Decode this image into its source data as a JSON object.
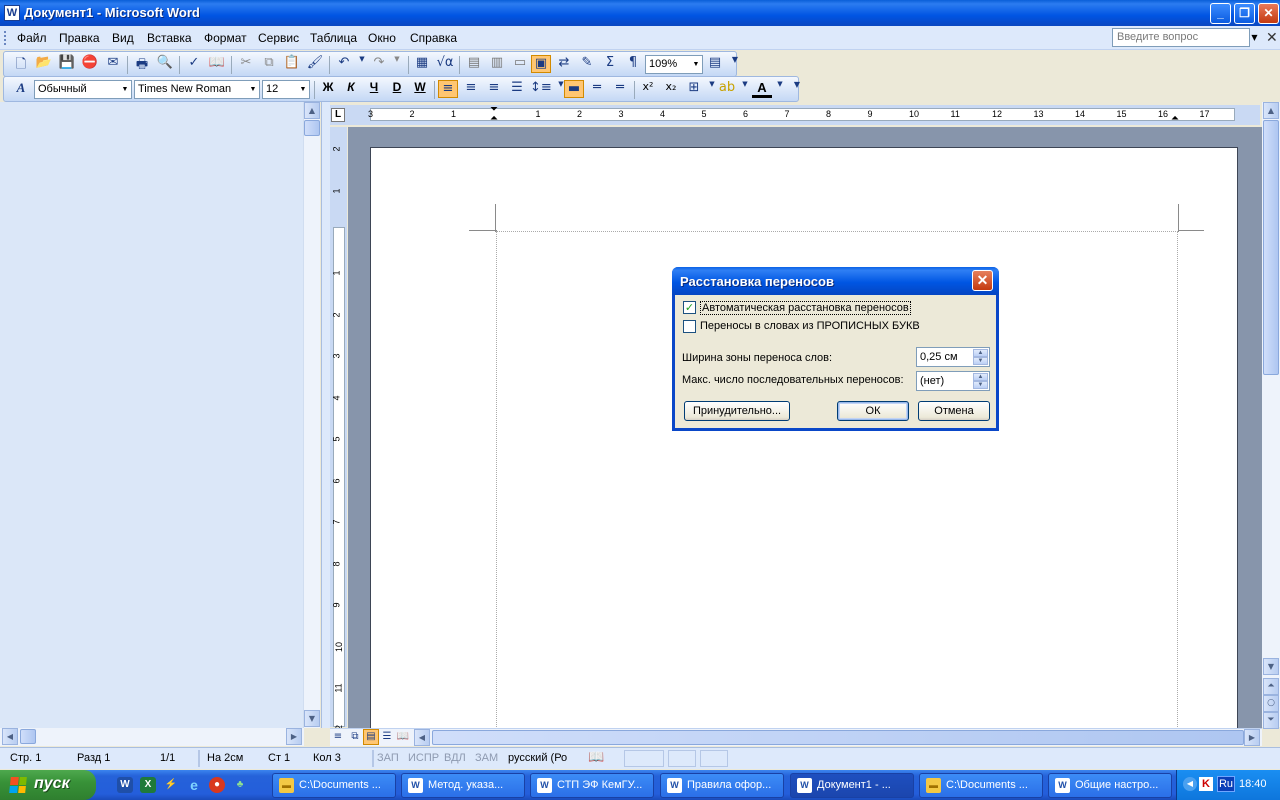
{
  "window": {
    "title": "Документ1 - Microsoft Word",
    "app_icon": "word-icon",
    "controls": [
      "minimize",
      "restore",
      "close"
    ]
  },
  "menubar": {
    "items": [
      "Файл",
      "Правка",
      "Вид",
      "Вставка",
      "Формат",
      "Сервис",
      "Таблица",
      "Окно",
      "Справка"
    ],
    "help_placeholder": "Введите вопрос"
  },
  "toolbar_standard": {
    "zoom": "109%"
  },
  "toolbar_formatting": {
    "style": "Обычный",
    "font": "Times New Roman",
    "size": "12",
    "bold": "Ж",
    "italic": "К",
    "underline": "Ч",
    "strike": "D",
    "wordart": "W"
  },
  "ruler": {
    "horizontal_numbers": [
      "3",
      "2",
      "1",
      "1",
      "2",
      "3",
      "4",
      "5",
      "6",
      "7",
      "8",
      "9",
      "10",
      "11",
      "12",
      "13",
      "14",
      "15",
      "16",
      "17"
    ],
    "vertical_numbers": [
      "2",
      "1",
      "1",
      "2",
      "3",
      "4",
      "5",
      "6",
      "7",
      "8",
      "9",
      "10",
      "11",
      "12"
    ],
    "tab_selector": "L"
  },
  "dialog": {
    "title": "Расстановка переносов",
    "auto_hyphenation_label": "Автоматическая расстановка переносов",
    "auto_hyphenation_checked": true,
    "caps_hyphenation_label": "Переносы в словах из ПРОПИСНЫХ БУКВ",
    "caps_hyphenation_checked": false,
    "zone_width_label": "Ширина зоны переноса слов:",
    "zone_width_value": "0,25 см",
    "max_consecutive_label": "Макс. число последовательных переносов:",
    "max_consecutive_value": "(нет)",
    "manual_button": "Принудительно...",
    "ok_button": "ОК",
    "cancel_button": "Отмена"
  },
  "statusbar": {
    "page": "Стр. 1",
    "section": "Разд 1",
    "pages": "1/1",
    "at": "На 2см",
    "line": "Ст 1",
    "col": "Кол 3",
    "rec": "ЗАП",
    "trk": "ИСПР",
    "ext": "ВДЛ",
    "ovr": "ЗАМ",
    "language": "русский (Ро"
  },
  "taskbar": {
    "start_label": "пуск",
    "tasks": [
      {
        "label": "C:\\Documents ...",
        "icon": "folder-icon",
        "active": false
      },
      {
        "label": "Метод. указа...",
        "icon": "word-icon",
        "active": false
      },
      {
        "label": "СТП ЭФ КемГУ...",
        "icon": "word-icon",
        "active": false
      },
      {
        "label": "Правила офор...",
        "icon": "word-icon",
        "active": false
      },
      {
        "label": "Документ1 - ...",
        "icon": "word-icon",
        "active": true
      },
      {
        "label": "C:\\Documents ...",
        "icon": "folder-icon",
        "active": false
      },
      {
        "label": "Общие настро...",
        "icon": "word-icon",
        "active": false
      }
    ],
    "language": "Ru",
    "clock": "18:40"
  }
}
